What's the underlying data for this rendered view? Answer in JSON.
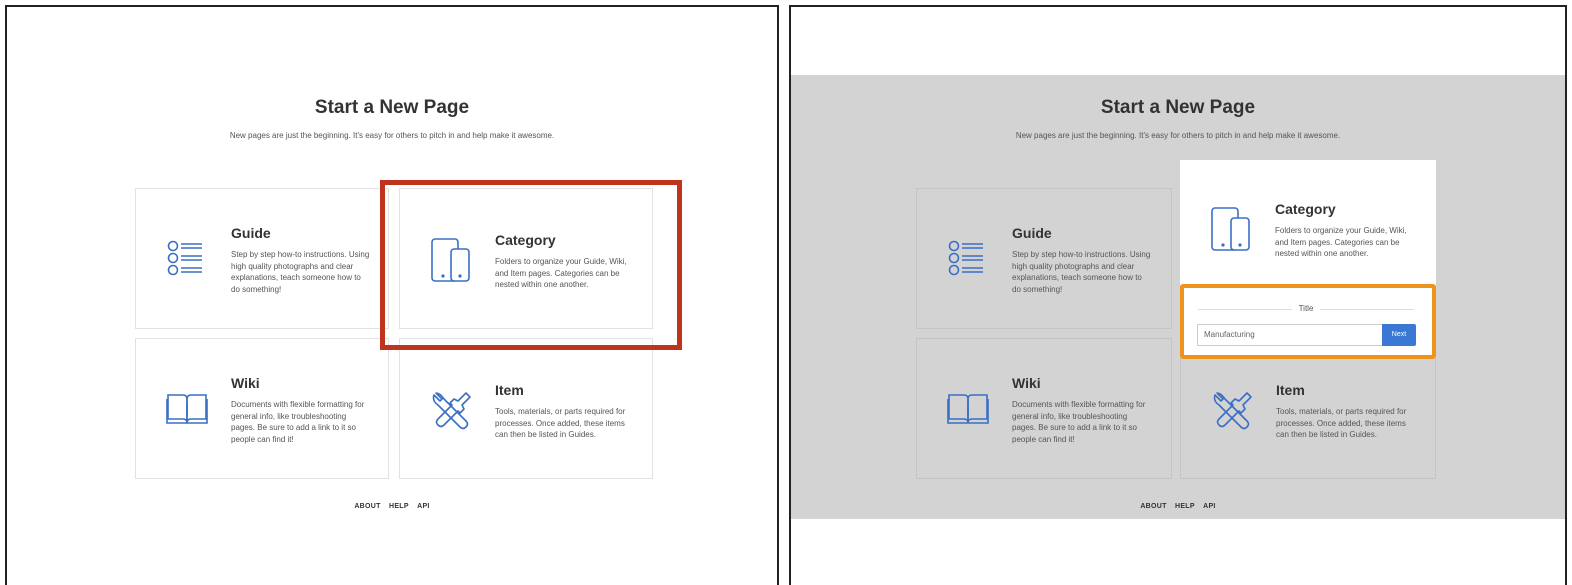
{
  "page": {
    "heading": "Start a New Page",
    "subheading": "New pages are just the beginning. It's easy for others to pitch in and help make it awesome."
  },
  "cards": {
    "guide": {
      "title": "Guide",
      "description": "Step by step how-to instructions. Using high quality photographs and clear explanations, teach someone how to do something!",
      "icon": "list-icon"
    },
    "category": {
      "title": "Category",
      "description": "Folders to organize your Guide, Wiki, and Item pages. Categories can be nested within one another.",
      "icon": "devices-icon"
    },
    "wiki": {
      "title": "Wiki",
      "description": "Documents with flexible formatting for general info, like troubleshooting pages. Be sure to add a link to it so people can find it!",
      "icon": "book-icon"
    },
    "item": {
      "title": "Item",
      "description": "Tools, materials, or parts required for processes. Once added, these items can then be listed in Guides.",
      "icon": "tools-icon"
    }
  },
  "footer": {
    "links": [
      "ABOUT",
      "HELP",
      "API"
    ]
  },
  "title_form": {
    "label": "Title",
    "input_value": "Manufacturing",
    "next_label": "Next"
  },
  "colors": {
    "accent": "#3a78d3",
    "highlight_red": "#c0331c",
    "highlight_orange": "#f0921e",
    "overlay": "#d3d3d3"
  }
}
